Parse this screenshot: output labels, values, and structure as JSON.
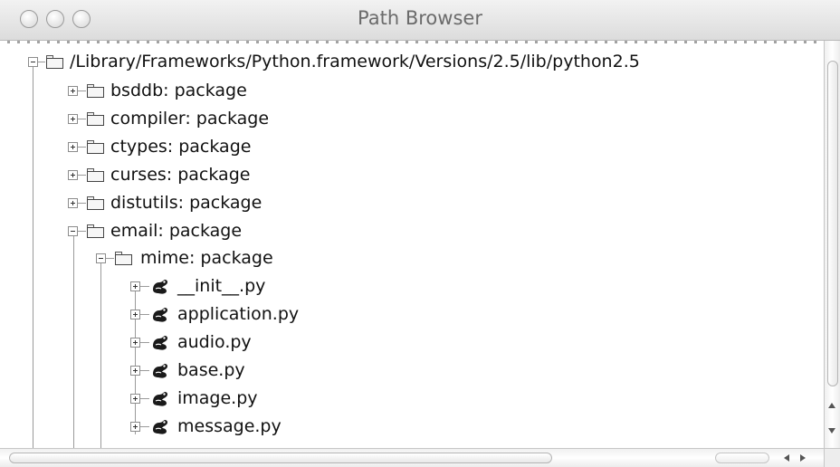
{
  "window": {
    "title": "Path Browser"
  },
  "tree": {
    "root": {
      "label": "/Library/Frameworks/Python.framework/Versions/2.5/lib/python2.5",
      "icon": "folder-icon",
      "expanded": true
    },
    "packages": [
      {
        "label": "bsddb: package",
        "icon": "folder-icon",
        "expanded": false
      },
      {
        "label": "compiler: package",
        "icon": "folder-icon",
        "expanded": false
      },
      {
        "label": "ctypes: package",
        "icon": "folder-icon",
        "expanded": false
      },
      {
        "label": "curses: package",
        "icon": "folder-icon",
        "expanded": false
      },
      {
        "label": "distutils: package",
        "icon": "folder-icon",
        "expanded": false
      },
      {
        "label": "email: package",
        "icon": "folder-icon",
        "expanded": true
      }
    ],
    "subpackage": {
      "label": "mime: package",
      "icon": "folder-icon",
      "expanded": true
    },
    "files": [
      {
        "label": "__init__.py",
        "icon": "python-file-icon"
      },
      {
        "label": "application.py",
        "icon": "python-file-icon"
      },
      {
        "label": "audio.py",
        "icon": "python-file-icon"
      },
      {
        "label": "base.py",
        "icon": "python-file-icon"
      },
      {
        "label": "image.py",
        "icon": "python-file-icon"
      },
      {
        "label": "message.py",
        "icon": "python-file-icon"
      }
    ]
  }
}
